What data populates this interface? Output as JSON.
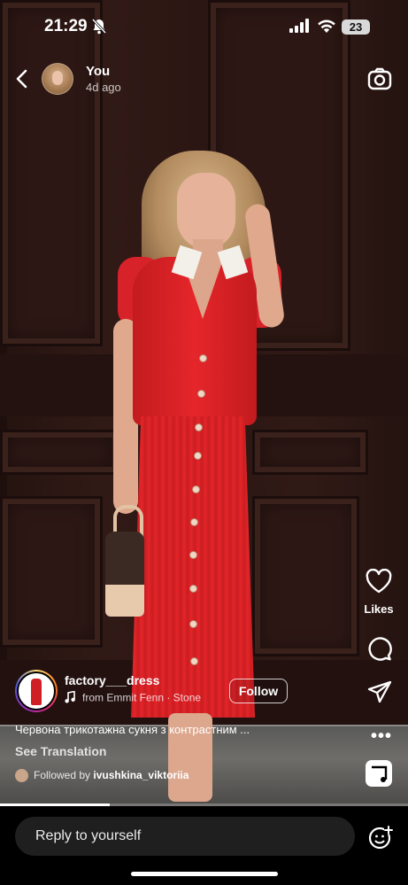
{
  "status_bar": {
    "time": "21:29",
    "battery": "23"
  },
  "header": {
    "username": "You",
    "posted_ago": "4d ago"
  },
  "actions": {
    "likes_label": "Likes"
  },
  "post": {
    "poster_name": "factory___dress",
    "audio": "from Emmit Fenn · Stone",
    "follow_label": "Follow",
    "caption": "Червона трикотажна сукня з контрастним ...",
    "see_translation": "See Translation",
    "followed_by_prefix": "Followed by",
    "followed_by_user": "ivushkina_viktoriia",
    "progress": 0.27
  },
  "reply": {
    "placeholder": "Reply to yourself"
  },
  "icons": {
    "back": "chevron-left-icon",
    "camera": "camera-icon",
    "like": "heart-icon",
    "comment": "comment-icon",
    "share": "send-icon",
    "more": "more-icon",
    "audio": "music-icon",
    "emoji": "emoji-plus-icon"
  },
  "colors": {
    "accent_red": "#e5262a",
    "background": "#000000"
  }
}
